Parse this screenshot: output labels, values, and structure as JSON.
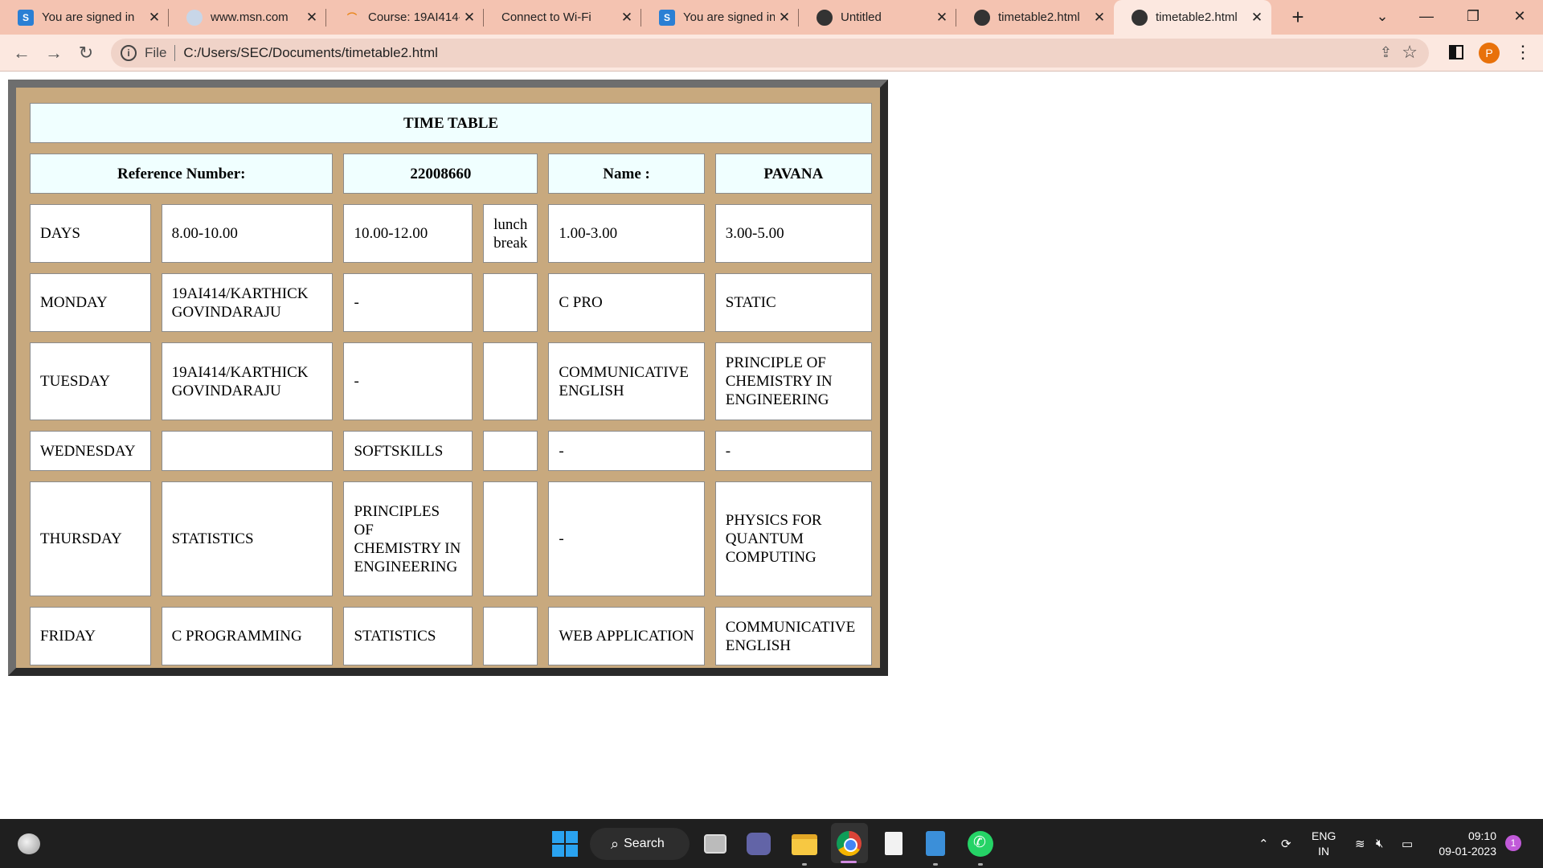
{
  "browser": {
    "tabs": [
      {
        "title": "You are signed in",
        "icon": "s-icon"
      },
      {
        "title": "www.msn.com",
        "icon": "msn-icon"
      },
      {
        "title": "Course: 19AI414-",
        "icon": "moodle-icon"
      },
      {
        "title": "Connect to Wi-Fi",
        "icon": ""
      },
      {
        "title": "You are signed in",
        "icon": "s-icon"
      },
      {
        "title": "Untitled",
        "icon": "globe-icon"
      },
      {
        "title": "timetable2.html",
        "icon": "globe-icon"
      },
      {
        "title": "timetable2.html",
        "icon": "globe-icon"
      }
    ],
    "address": {
      "scheme": "File",
      "url": "C:/Users/SEC/Documents/timetable2.html"
    },
    "profile_initial": "P"
  },
  "timetable": {
    "title": "TIME TABLE",
    "reference_label": "Reference Number:",
    "reference_value": "22008660",
    "name_label": "Name :",
    "name_value": "PAVANA",
    "header": {
      "days": "DAYS",
      "slot1": "8.00-10.00",
      "slot2": "10.00-12.00",
      "lunch": "lunch break",
      "slot3": "1.00-3.00",
      "slot4": "3.00-5.00"
    },
    "rows": [
      {
        "day": "MONDAY",
        "s1": "19AI414/KARTHICK GOVINDARAJU",
        "s2": "-",
        "lunch": "",
        "s3": "C PRO",
        "s4": "STATIC"
      },
      {
        "day": "TUESDAY",
        "s1": "19AI414/KARTHICK GOVINDARAJU",
        "s2": "-",
        "lunch": "",
        "s3": "COMMUNICATIVE ENGLISH",
        "s4": "PRINCIPLE OF CHEMISTRY IN ENGINEERING"
      },
      {
        "day": "WEDNESDAY",
        "s1": "",
        "s2": "SOFTSKILLS",
        "lunch": "",
        "s3": "-",
        "s4": "-"
      },
      {
        "day": "THURSDAY",
        "s1": "STATISTICS",
        "s2": "PRINCIPLES OF CHEMISTRY IN ENGINEERING",
        "lunch": "",
        "s3": "-",
        "s4": "PHYSICS FOR QUANTUM COMPUTING"
      },
      {
        "day": "FRIDAY",
        "s1": "C PROGRAMMING",
        "s2": "STATISTICS",
        "lunch": "",
        "s3": "WEB APPLICATION",
        "s4": "COMMUNICATIVE ENGLISH"
      }
    ]
  },
  "taskbar": {
    "search_label": "Search",
    "lang_line1": "ENG",
    "lang_line2": "IN",
    "time": "09:10",
    "date": "09-01-2023",
    "notification_count": "1"
  }
}
